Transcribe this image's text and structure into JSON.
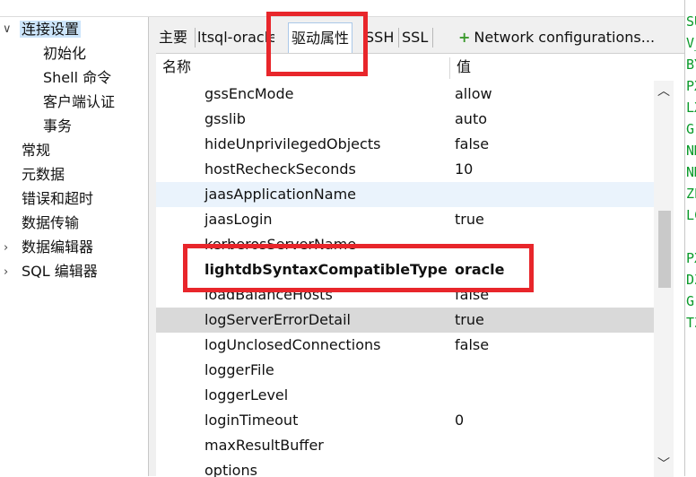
{
  "nav": {
    "items": [
      {
        "label": "连接设置",
        "toggle": "∨"
      },
      {
        "label": "初始化"
      },
      {
        "label": "Shell 命令"
      },
      {
        "label": "客户端认证"
      },
      {
        "label": "事务"
      },
      {
        "label": "常规"
      },
      {
        "label": "元数据"
      },
      {
        "label": "错误和超时"
      },
      {
        "label": "数据传输"
      },
      {
        "label": "数据编辑器",
        "toggle": "›"
      },
      {
        "label": "SQL 编辑器",
        "toggle": "›"
      }
    ]
  },
  "tabs": [
    {
      "label": "主要"
    },
    {
      "label": "ltsql-oracle"
    },
    {
      "label": "驱动属性"
    },
    {
      "label": "SSH"
    },
    {
      "label": "SSL"
    }
  ],
  "network_config": {
    "icon": "+",
    "label": "Network configurations..."
  },
  "table": {
    "headers": {
      "name": "名称",
      "value": "值"
    },
    "rows": [
      {
        "name": "gssEncMode",
        "value": "allow"
      },
      {
        "name": "gsslib",
        "value": "auto"
      },
      {
        "name": "hideUnprivilegedObjects",
        "value": "false"
      },
      {
        "name": "hostRecheckSeconds",
        "value": "10"
      },
      {
        "name": "jaasApplicationName",
        "value": ""
      },
      {
        "name": "jaasLogin",
        "value": "true"
      },
      {
        "name": "kerberosServerName",
        "value": ""
      },
      {
        "name": "lightdbSyntaxCompatibleType",
        "value": "oracle"
      },
      {
        "name": "loadBalanceHosts",
        "value": "false"
      },
      {
        "name": "logServerErrorDetail",
        "value": "true"
      },
      {
        "name": "logUnclosedConnections",
        "value": "false"
      },
      {
        "name": "loggerFile",
        "value": ""
      },
      {
        "name": "loggerLevel",
        "value": ""
      },
      {
        "name": "loginTimeout",
        "value": "0"
      },
      {
        "name": "maxResultBuffer",
        "value": ""
      },
      {
        "name": "options",
        "value": ""
      }
    ]
  },
  "scroll": {
    "up": "︿",
    "down": "﹀"
  },
  "terminal_lines": [
    "SU",
    "V_",
    "BY",
    "PX",
    "LX",
    "G",
    "NM",
    "NM",
    "ZE",
    "LC",
    "",
    "PX",
    "DZ",
    "G)",
    "TZ"
  ],
  "colors": {
    "highlight": "#e8262b",
    "selection": "#cce5fb",
    "terminal_text": "#0a9a2a"
  }
}
